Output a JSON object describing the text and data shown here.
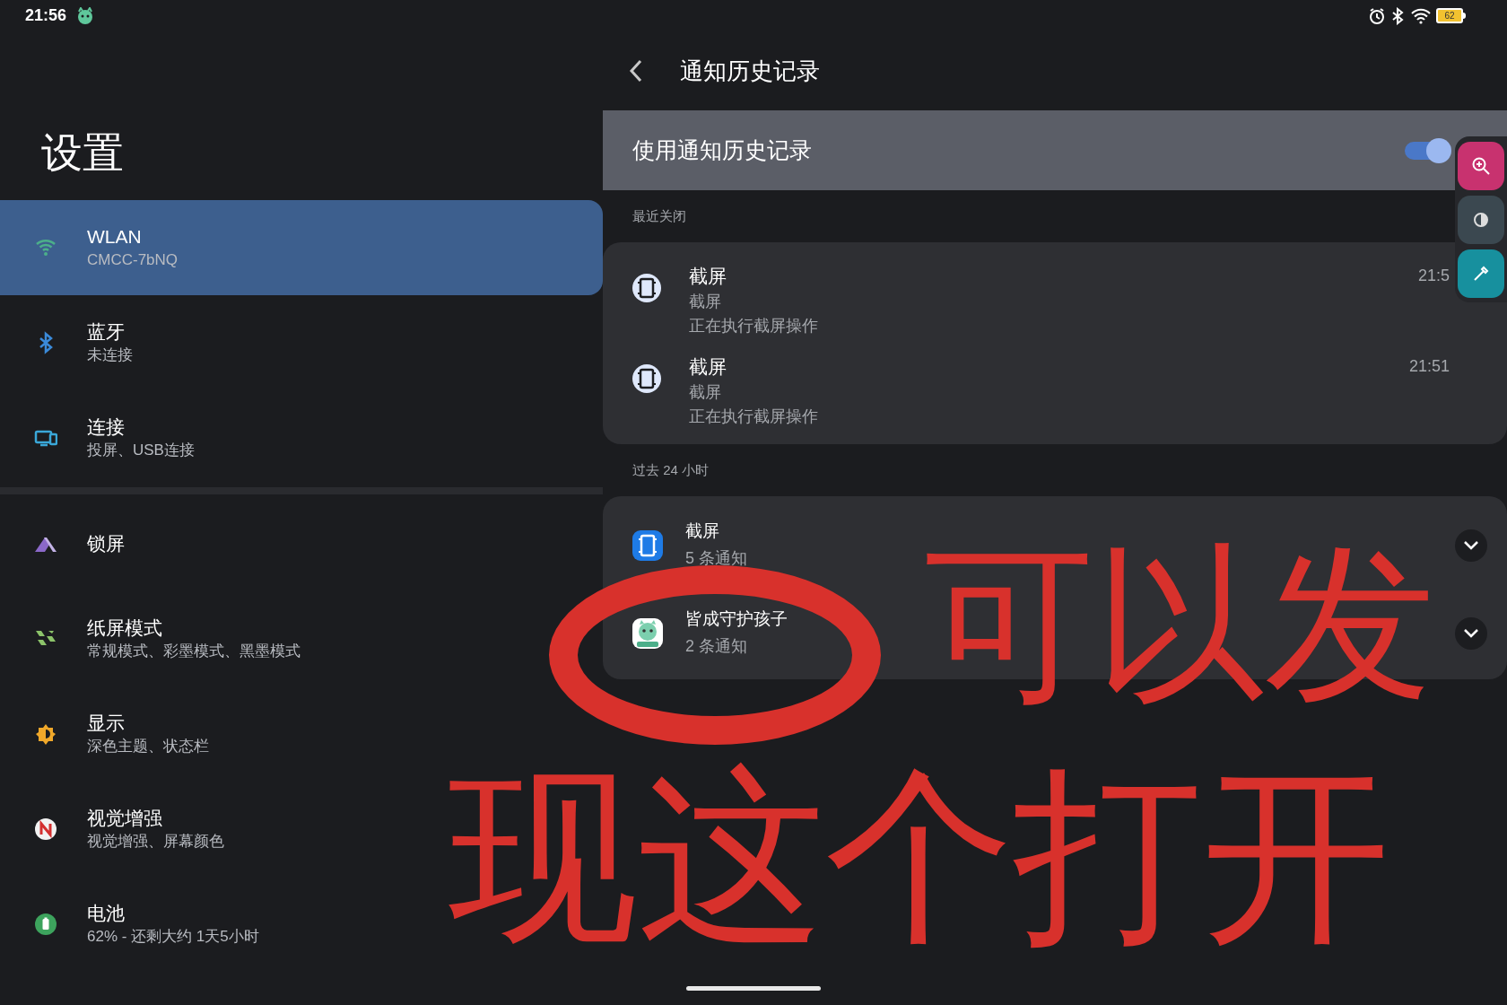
{
  "status_bar": {
    "time": "21:56",
    "battery": "62"
  },
  "sidebar": {
    "title": "设置",
    "groups": [
      [
        {
          "label": "WLAN",
          "subtitle": "CMCC-7bNQ",
          "selected": true
        },
        {
          "label": "蓝牙",
          "subtitle": "未连接",
          "selected": false
        },
        {
          "label": "连接",
          "subtitle": "投屏、USB连接",
          "selected": false
        }
      ],
      [
        {
          "label": "锁屏",
          "selected": false
        },
        {
          "label": "纸屏模式",
          "subtitle": "常规模式、彩墨模式、黑墨模式",
          "selected": false
        },
        {
          "label": "显示",
          "subtitle": "深色主题、状态栏",
          "selected": false
        },
        {
          "label": "视觉增强",
          "subtitle": "视觉增强、屏幕颜色",
          "selected": false
        },
        {
          "label": "电池",
          "subtitle": "62% - 还剩大约 1天5小时",
          "selected": false
        }
      ]
    ]
  },
  "detail": {
    "title": "通知历史记录",
    "master_switch": {
      "label": "使用通知历史记录",
      "on": true
    },
    "sections": [
      {
        "header": "最近关闭",
        "kind": "recent",
        "items": [
          {
            "title": "截屏",
            "app": "截屏",
            "text": "正在执行截屏操作",
            "time": "21:5"
          },
          {
            "title": "截屏",
            "app": "截屏",
            "text": "正在执行截屏操作",
            "time": "21:51"
          }
        ]
      },
      {
        "header": "过去 24 小时",
        "kind": "grouped",
        "items": [
          {
            "title": "截屏",
            "count": "5 条通知"
          },
          {
            "title": "皆成守护孩子",
            "count": "2 条通知"
          }
        ]
      }
    ]
  },
  "annotation": {
    "lines": [
      "可以发",
      "现这个打开"
    ]
  }
}
